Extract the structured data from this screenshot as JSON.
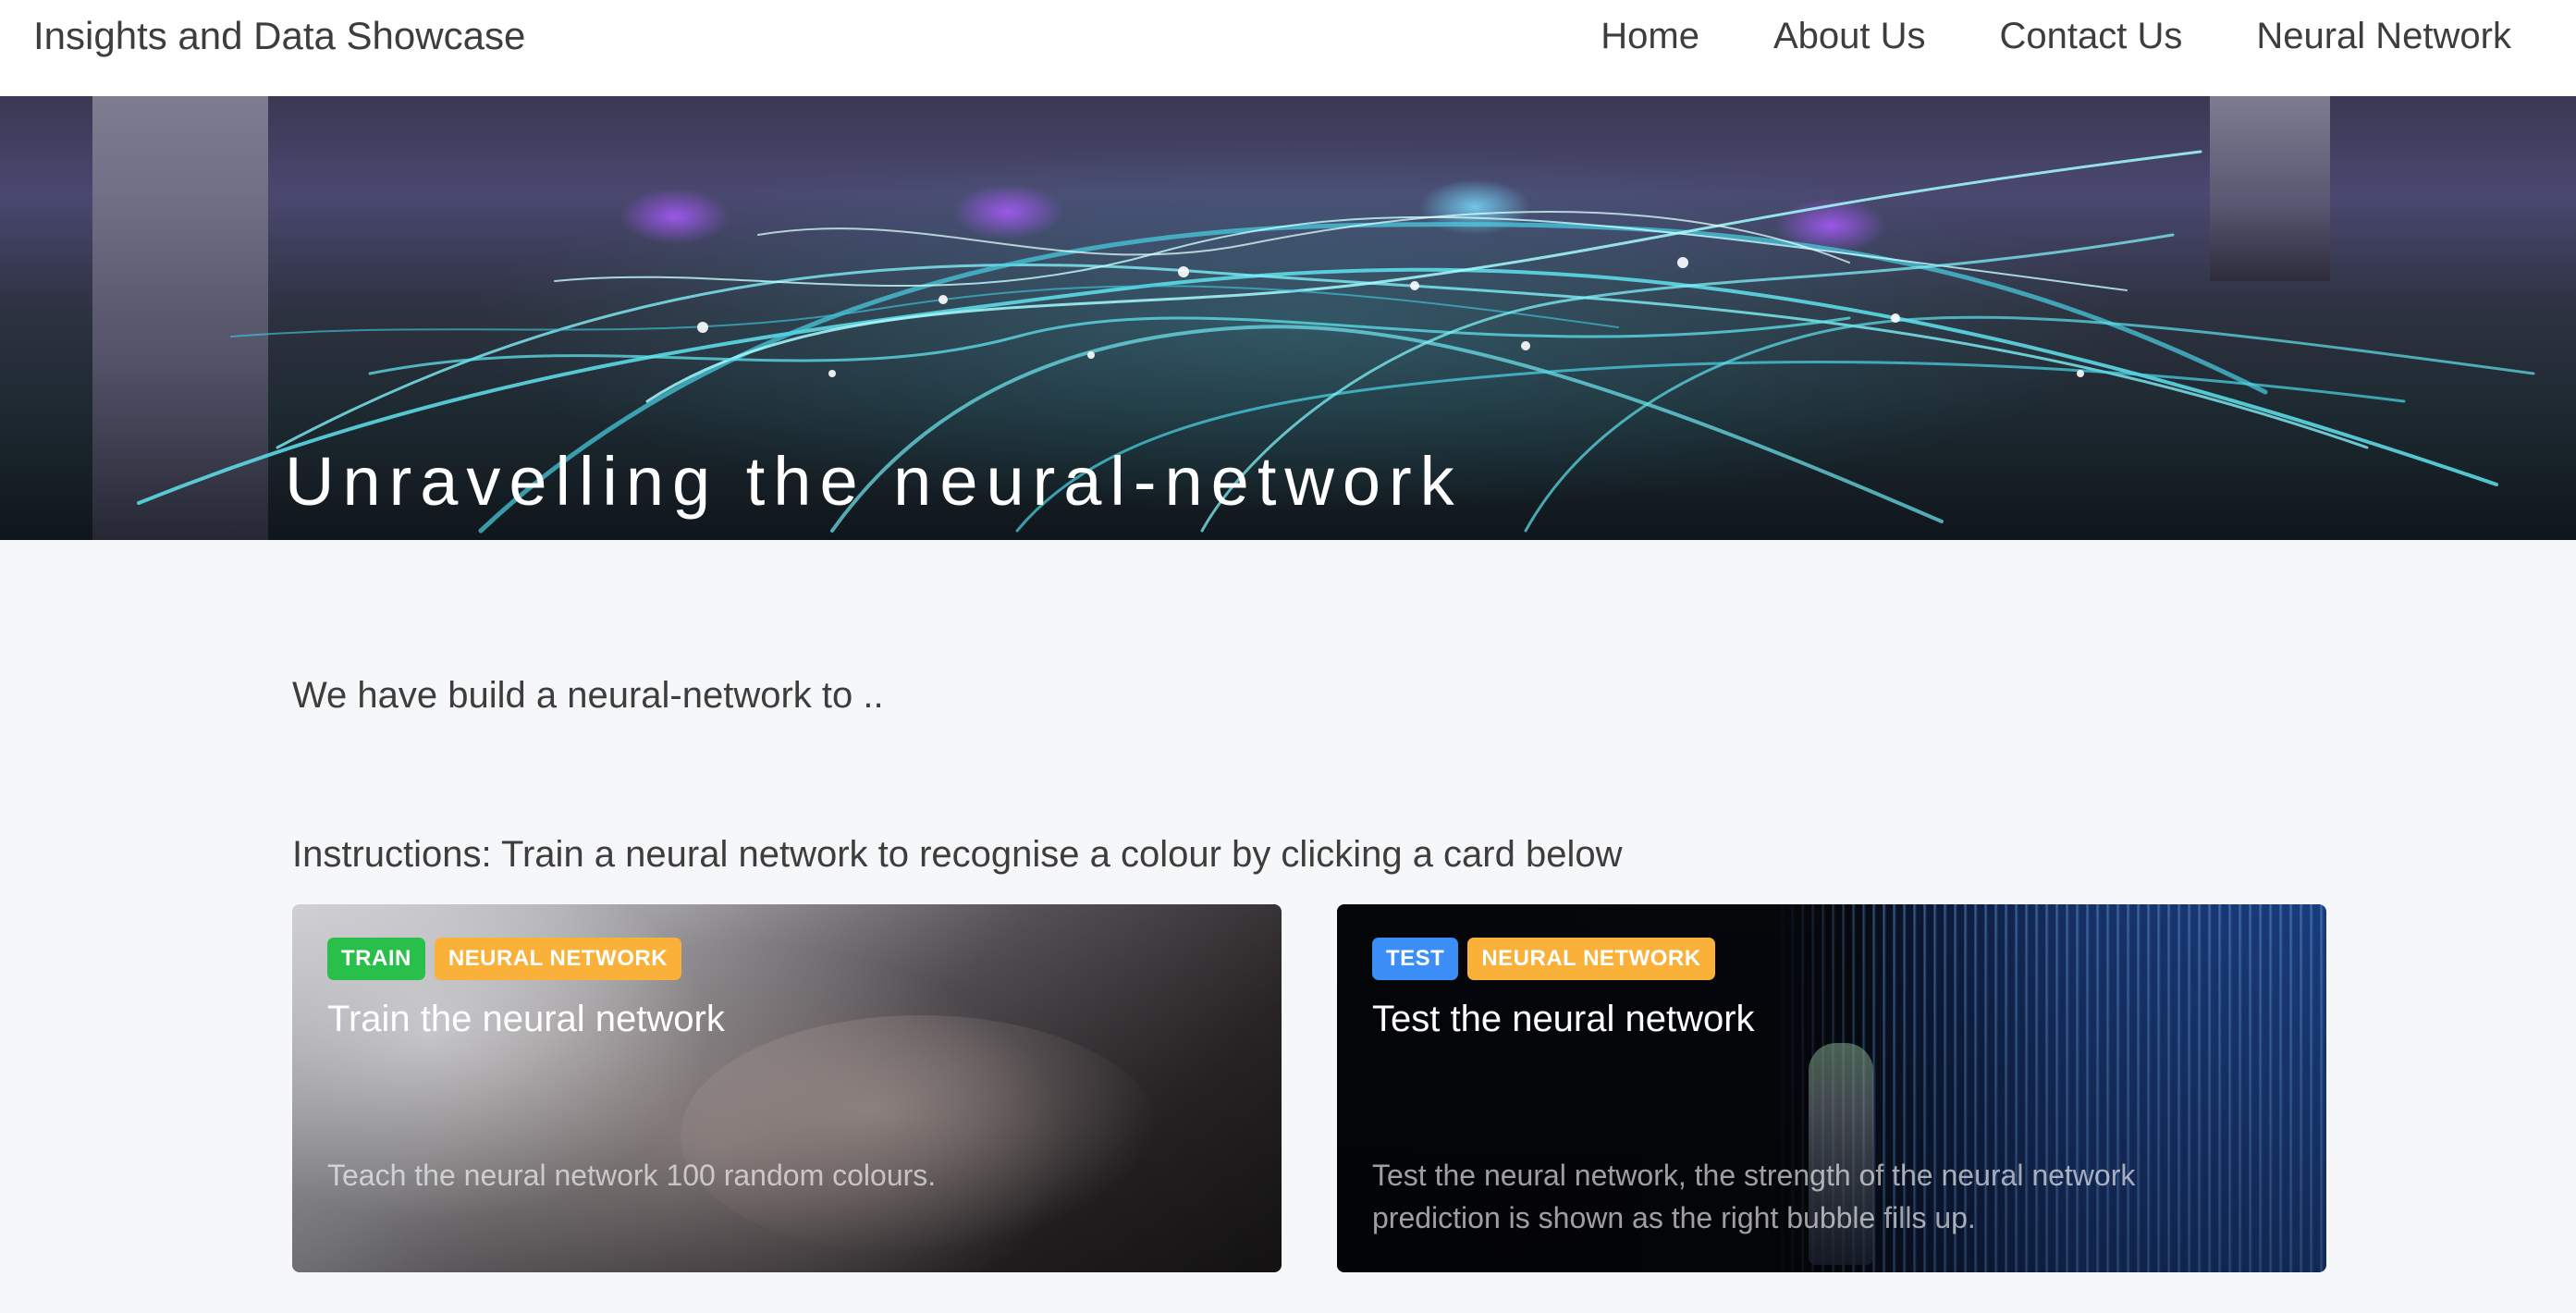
{
  "navbar": {
    "brand": "Insights and Data Showcase",
    "links": [
      {
        "label": "Home"
      },
      {
        "label": "About Us"
      },
      {
        "label": "Contact Us"
      },
      {
        "label": "Neural Network"
      }
    ]
  },
  "hero": {
    "title": "Unravelling the neural-network"
  },
  "main": {
    "intro": "We have build a neural-network to ..",
    "instructions": "Instructions: Train a neural network to recognise a colour by clicking a card below",
    "cards": [
      {
        "badges": [
          {
            "label": "TRAIN",
            "color": "#28c04a"
          },
          {
            "label": "NEURAL NETWORK",
            "color": "#f9b13a"
          }
        ],
        "title": "Train the neural network",
        "text": "Teach the neural network 100 random colours."
      },
      {
        "badges": [
          {
            "label": "TEST",
            "color": "#3a8ef6"
          },
          {
            "label": "NEURAL NETWORK",
            "color": "#f9b13a"
          }
        ],
        "title": "Test the neural network",
        "text": "Test the neural network, the strength of the neural network prediction is shown as the right bubble fills up."
      }
    ]
  },
  "colors": {
    "page_background": "#f6f7f9",
    "text": "#3d3d3d",
    "navbar_background": "#ffffff"
  }
}
